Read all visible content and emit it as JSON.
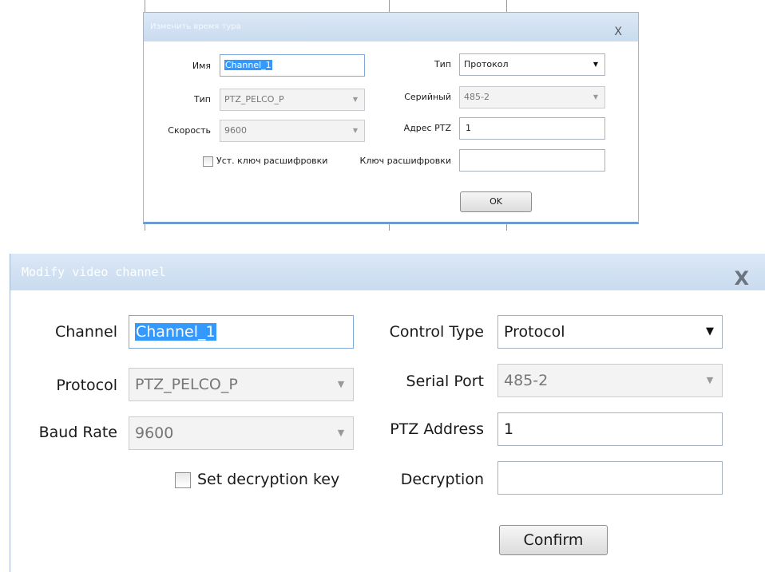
{
  "dialog_ru": {
    "title": "Изменить время тура",
    "close": "X",
    "name_label": "Имя",
    "name_value": "Channel_1",
    "type_label": "Тип",
    "type_value": "PTZ_PELCO_P",
    "speed_label": "Скорость",
    "speed_value": "9600",
    "decrypt_checkbox_label": "Уст. ключ расшифровки",
    "control_type_label": "Тип",
    "control_type_value": "Протокол",
    "serial_label": "Серийный",
    "serial_value": "485-2",
    "ptz_address_label": "Адрес PTZ",
    "ptz_address_value": "1",
    "decrypt_key_label": "Ключ расшифровки",
    "decrypt_key_value": "",
    "ok_label": "OK"
  },
  "dialog_en": {
    "title": "Modify video channel",
    "close": "X",
    "channel_label": "Channel",
    "channel_value": "Channel_1",
    "protocol_label": "Protocol",
    "protocol_value": "PTZ_PELCO_P",
    "baud_label": "Baud Rate",
    "baud_value": "9600",
    "decrypt_checkbox_label": "Set decryption key",
    "control_type_label": "Control Type",
    "control_type_value": "Protocol",
    "serial_label": "Serial Port",
    "serial_value": "485-2",
    "ptz_address_label": "PTZ Address",
    "ptz_address_value": "1",
    "decryption_label": "Decryption",
    "decryption_value": "",
    "confirm_label": "Confirm"
  },
  "icons": {
    "dropdown": "chevron-down-icon"
  },
  "colors": {
    "titlebar": "#d4e3f3",
    "selection": "#3399ff",
    "frame_accent": "#6c9bd1"
  }
}
